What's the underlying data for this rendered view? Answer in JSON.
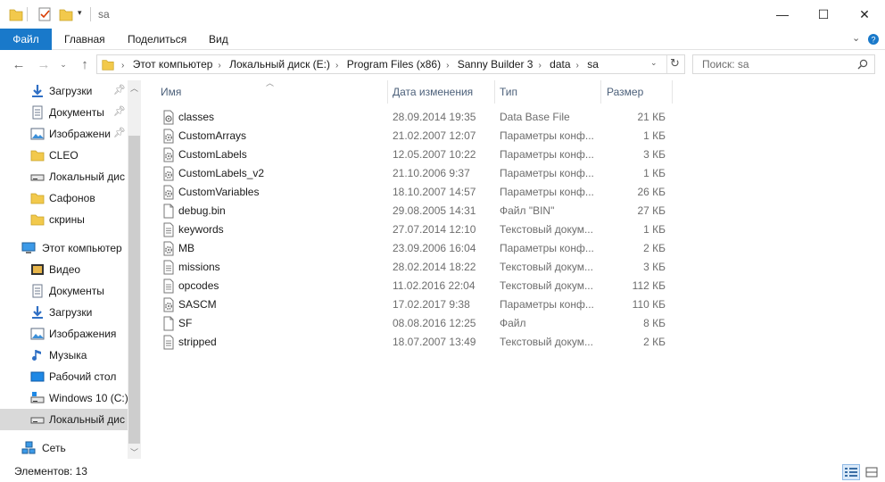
{
  "window": {
    "title": "sa",
    "controls": {
      "minimize": "—",
      "maximize": "☐",
      "close": "✕"
    }
  },
  "ribbon": {
    "tabs": [
      {
        "label": "Файл"
      },
      {
        "label": "Главная"
      },
      {
        "label": "Поделиться"
      },
      {
        "label": "Вид"
      }
    ]
  },
  "address": {
    "crumbs": [
      "Этот компьютер",
      "Локальный диск (E:)",
      "Program Files (x86)",
      "Sanny Builder 3",
      "data",
      "sa"
    ],
    "search_placeholder": "Поиск: sa"
  },
  "nav": {
    "items": [
      {
        "label": "Загрузки",
        "icon": "download-icon",
        "pinned": true
      },
      {
        "label": "Документы",
        "icon": "documents-icon",
        "pinned": true
      },
      {
        "label": "Изображени",
        "icon": "pictures-icon",
        "pinned": true
      },
      {
        "label": "CLEO",
        "icon": "folder-icon",
        "pinned": false
      },
      {
        "label": "Локальный дис",
        "icon": "drive-icon",
        "pinned": false
      },
      {
        "label": "Сафонов",
        "icon": "folder-icon",
        "pinned": false
      },
      {
        "label": "скрины",
        "icon": "folder-icon",
        "pinned": false
      },
      {
        "label": "Этот компьютер",
        "icon": "computer-icon",
        "pinned": false,
        "root": true
      },
      {
        "label": "Видео",
        "icon": "video-icon",
        "pinned": false
      },
      {
        "label": "Документы",
        "icon": "documents-icon",
        "pinned": false
      },
      {
        "label": "Загрузки",
        "icon": "download-icon",
        "pinned": false
      },
      {
        "label": "Изображения",
        "icon": "pictures-icon",
        "pinned": false
      },
      {
        "label": "Музыка",
        "icon": "music-icon",
        "pinned": false
      },
      {
        "label": "Рабочий стол",
        "icon": "desktop-icon",
        "pinned": false
      },
      {
        "label": "Windows 10 (C:)",
        "icon": "windows-drive-icon",
        "pinned": false
      },
      {
        "label": "Локальный дис",
        "icon": "drive-icon",
        "pinned": false,
        "selected": true
      },
      {
        "label": "Сеть",
        "icon": "network-icon",
        "pinned": false,
        "root": true
      }
    ]
  },
  "columns": {
    "name": "Имя",
    "date": "Дата изменения",
    "type": "Тип",
    "size": "Размер"
  },
  "files": [
    {
      "name": "classes",
      "date": "28.09.2014 19:35",
      "type": "Data Base File",
      "size": "21 КБ",
      "icon": "settings-file-icon"
    },
    {
      "name": "CustomArrays",
      "date": "21.02.2007 12:07",
      "type": "Параметры конф...",
      "size": "1 КБ",
      "icon": "config-file-icon"
    },
    {
      "name": "CustomLabels",
      "date": "12.05.2007 10:22",
      "type": "Параметры конф...",
      "size": "3 КБ",
      "icon": "config-file-icon"
    },
    {
      "name": "CustomLabels_v2",
      "date": "21.10.2006 9:37",
      "type": "Параметры конф...",
      "size": "1 КБ",
      "icon": "config-file-icon"
    },
    {
      "name": "CustomVariables",
      "date": "18.10.2007 14:57",
      "type": "Параметры конф...",
      "size": "26 КБ",
      "icon": "config-file-icon"
    },
    {
      "name": "debug.bin",
      "date": "29.08.2005 14:31",
      "type": "Файл \"BIN\"",
      "size": "27 КБ",
      "icon": "blank-file-icon"
    },
    {
      "name": "keywords",
      "date": "27.07.2014 12:10",
      "type": "Текстовый докум...",
      "size": "1 КБ",
      "icon": "text-file-icon"
    },
    {
      "name": "MB",
      "date": "23.09.2006 16:04",
      "type": "Параметры конф...",
      "size": "2 КБ",
      "icon": "config-file-icon"
    },
    {
      "name": "missions",
      "date": "28.02.2014 18:22",
      "type": "Текстовый докум...",
      "size": "3 КБ",
      "icon": "text-file-icon"
    },
    {
      "name": "opcodes",
      "date": "11.02.2016 22:04",
      "type": "Текстовый докум...",
      "size": "112 КБ",
      "icon": "text-file-icon"
    },
    {
      "name": "SASCM",
      "date": "17.02.2017 9:38",
      "type": "Параметры конф...",
      "size": "110 КБ",
      "icon": "config-file-icon"
    },
    {
      "name": "SF",
      "date": "08.08.2016 12:25",
      "type": "Файл",
      "size": "8 КБ",
      "icon": "blank-file-icon"
    },
    {
      "name": "stripped",
      "date": "18.07.2007 13:49",
      "type": "Текстовый докум...",
      "size": "2 КБ",
      "icon": "text-file-icon"
    }
  ],
  "status": {
    "count_text": "Элементов: 13"
  },
  "colors": {
    "accent": "#1979ca",
    "header_text": "#4c607a",
    "folder": "#f2c94c"
  }
}
